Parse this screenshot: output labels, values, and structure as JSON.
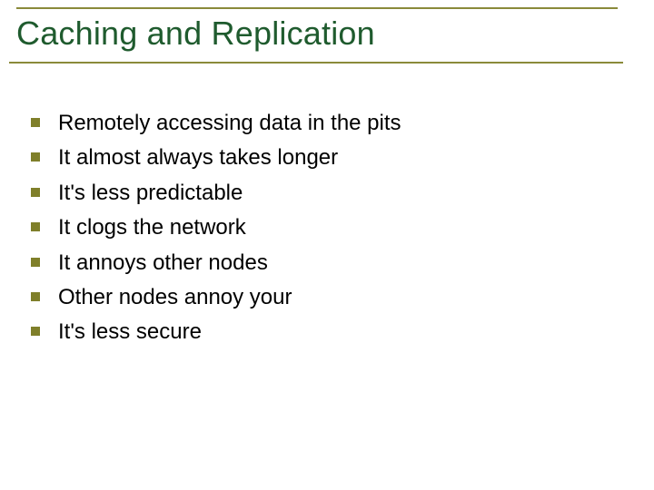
{
  "title": "Caching and Replication",
  "bullets": [
    "Remotely accessing data in the pits",
    "It almost always takes longer",
    "It's less predictable",
    "It clogs the network",
    "It annoys other nodes",
    "Other nodes annoy your",
    "It's less secure"
  ]
}
